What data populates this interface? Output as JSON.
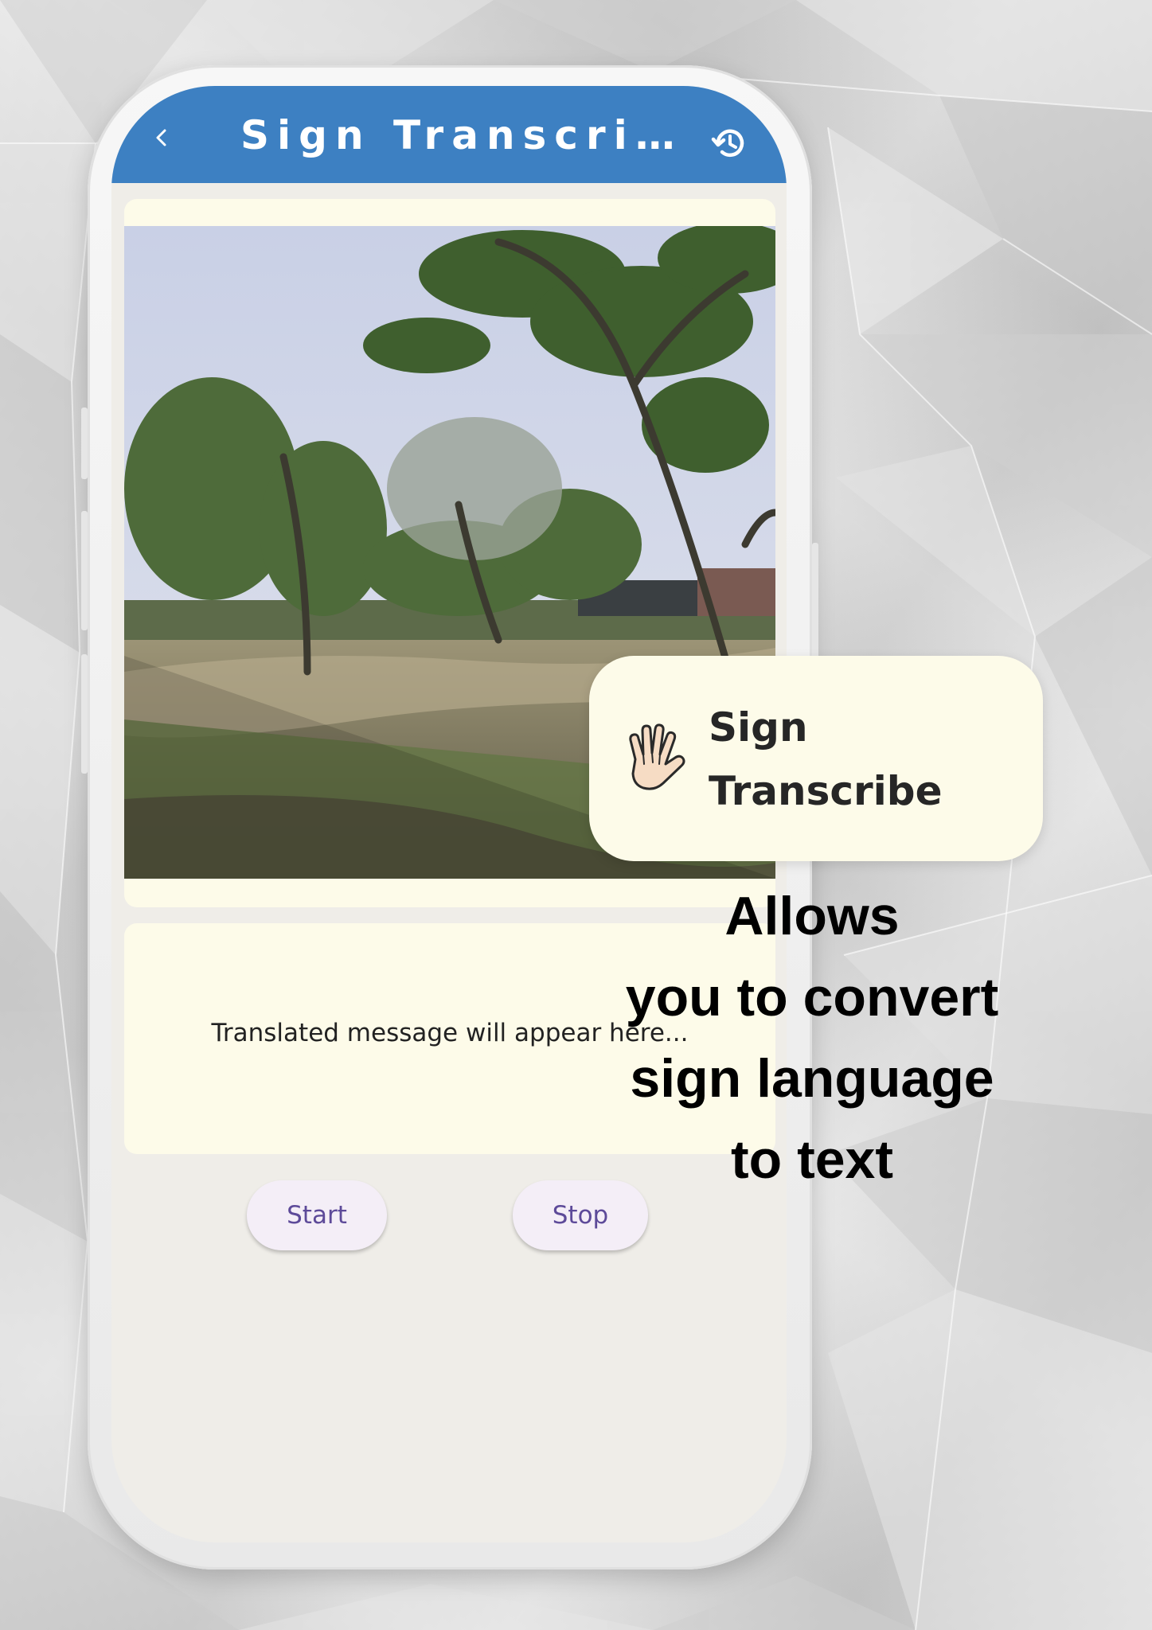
{
  "app_bar": {
    "title": "Sign Transcri…",
    "back_icon": "chevron-left-icon",
    "history_icon": "history-icon",
    "color": "#3d80c2"
  },
  "message_card": {
    "placeholder": "Translated message will appear here..."
  },
  "controls": {
    "start_label": "Start",
    "stop_label": "Stop"
  },
  "feature_card": {
    "icon": "hand-icon",
    "title_line1": "Sign",
    "title_line2": "Transcribe"
  },
  "tagline": {
    "line1": "Allows",
    "line2": "you to convert",
    "line3": "sign language",
    "line4": "to text"
  }
}
